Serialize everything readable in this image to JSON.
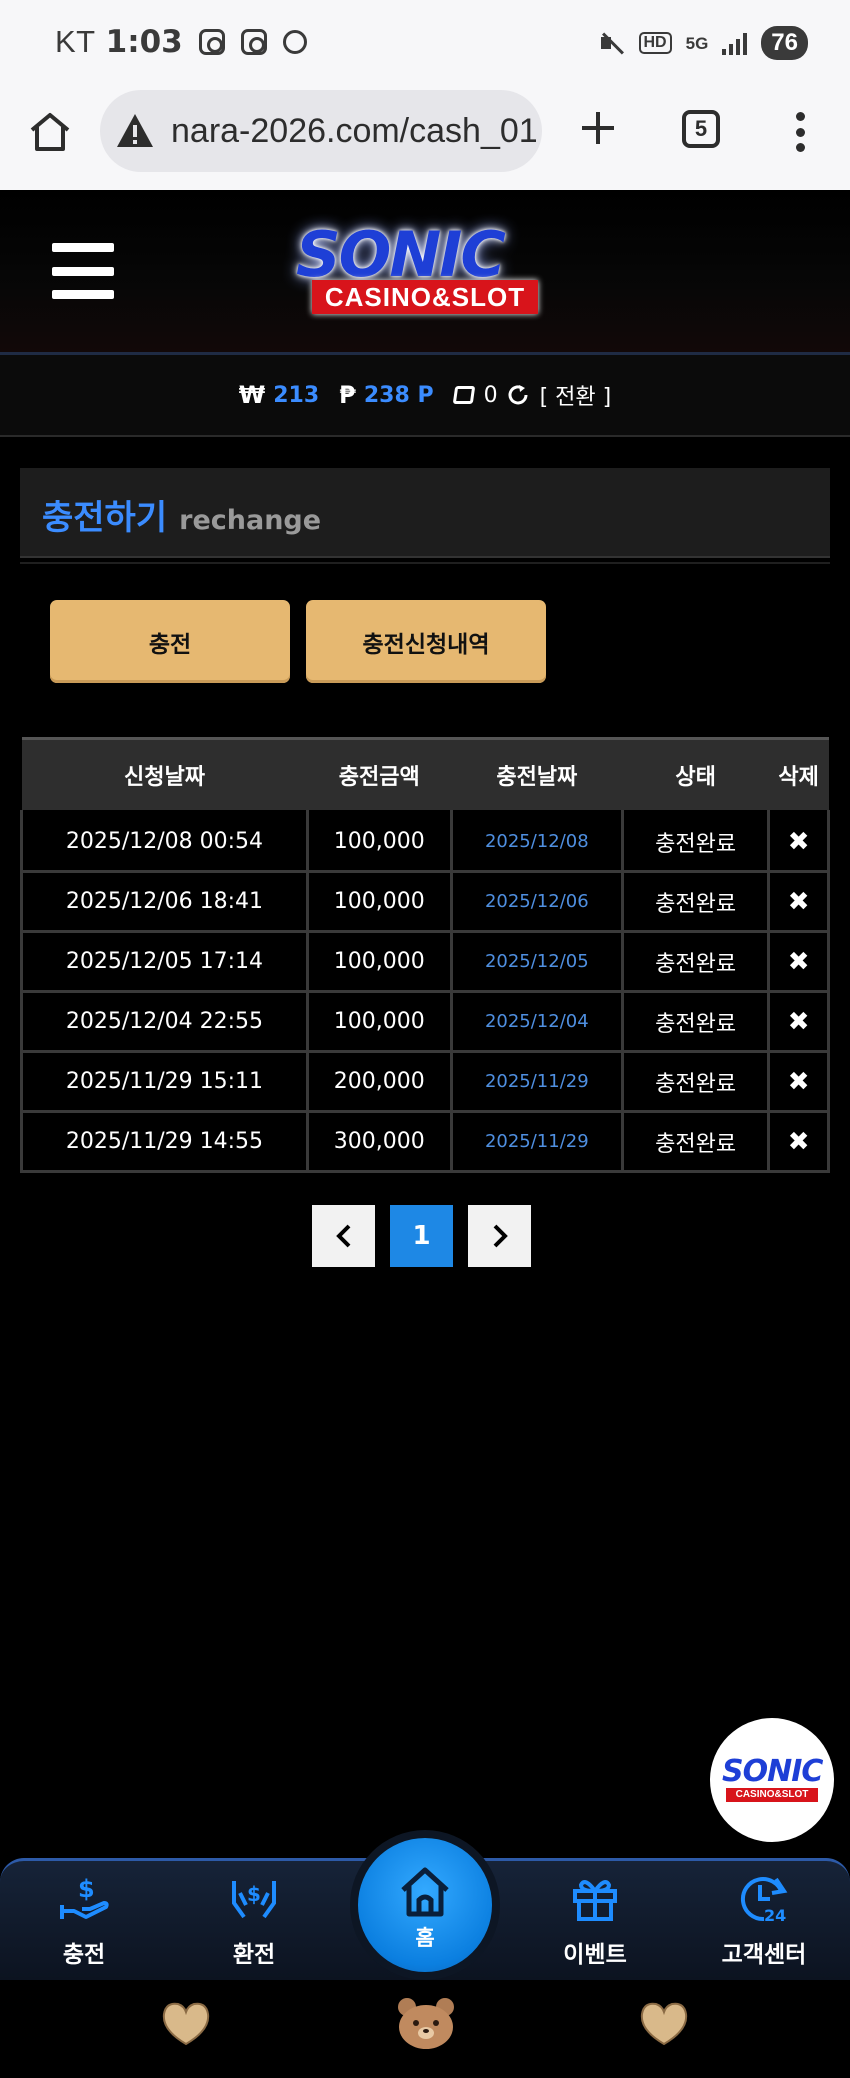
{
  "status_bar": {
    "carrier": "KT",
    "time": "1:03",
    "network": "5G",
    "hd_label": "HD",
    "battery": "76"
  },
  "browser": {
    "url": "nara-2026.com/cash_01",
    "tab_count": "5"
  },
  "site": {
    "logo_word": "SONIC",
    "logo_tag": "CASINO&SLOT"
  },
  "balance": {
    "won_symbol": "₩",
    "cash": "213",
    "point_symbol": "₱",
    "points": "238 P",
    "tickets": "0",
    "switch_label": "[ 전환 ]"
  },
  "page": {
    "title_ko": "충전하기",
    "title_en": "rechange"
  },
  "buttons": {
    "charge": "충전",
    "history": "충전신청내역"
  },
  "table": {
    "headers": [
      "신청날짜",
      "충전금액",
      "충전날짜",
      "상태",
      "삭제"
    ],
    "rows": [
      {
        "request_date": "2025/12/08 00:54",
        "amount": "100,000",
        "charge_date": "2025/12/08",
        "status": "충전완료",
        "delete": "✖"
      },
      {
        "request_date": "2025/12/06 18:41",
        "amount": "100,000",
        "charge_date": "2025/12/06",
        "status": "충전완료",
        "delete": "✖"
      },
      {
        "request_date": "2025/12/05 17:14",
        "amount": "100,000",
        "charge_date": "2025/12/05",
        "status": "충전완료",
        "delete": "✖"
      },
      {
        "request_date": "2025/12/04 22:55",
        "amount": "100,000",
        "charge_date": "2025/12/04",
        "status": "충전완료",
        "delete": "✖"
      },
      {
        "request_date": "2025/11/29 15:11",
        "amount": "200,000",
        "charge_date": "2025/11/29",
        "status": "충전완료",
        "delete": "✖"
      },
      {
        "request_date": "2025/11/29 14:55",
        "amount": "300,000",
        "charge_date": "2025/11/29",
        "status": "충전완료",
        "delete": "✖"
      }
    ]
  },
  "pagination": {
    "prev": "‹",
    "current": "1",
    "next": "›"
  },
  "floating_logo": {
    "word": "SONIC",
    "tag": "CASINO&SLOT"
  },
  "bottom_nav": {
    "charge": "충전",
    "exchange": "환전",
    "home": "홈",
    "event": "이벤트",
    "support": "고객센터"
  },
  "colors": {
    "accent_blue": "#3b8cff",
    "gold_button": "#e6b871",
    "brand_red": "#d8141b"
  }
}
